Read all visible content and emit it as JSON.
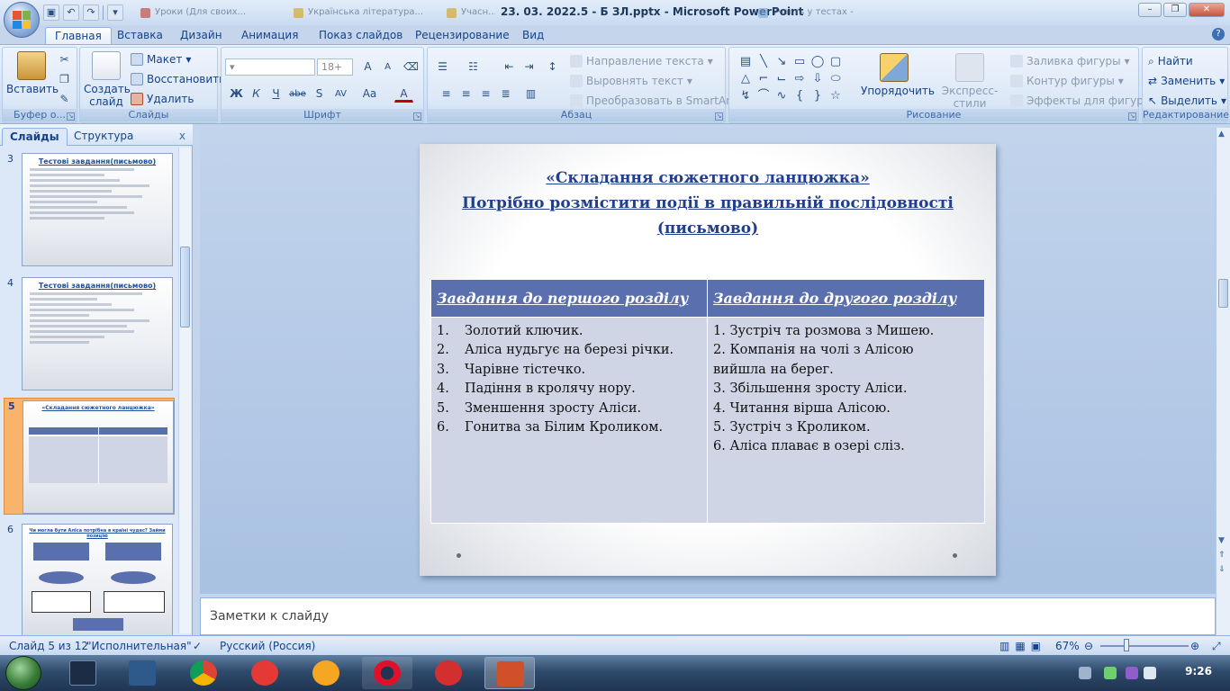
{
  "window": {
    "title": "23. 03. 2022.5 - Б ЗЛ.pptx - Microsoft PowerPoint",
    "background_tabs": [
      "Уроки (Для своих...",
      "Українська література...",
      "Учасн...",
      "Участь у тестах - "
    ]
  },
  "ribbon": {
    "tabs": [
      "Главная",
      "Вставка",
      "Дизайн",
      "Анимация",
      "Показ слайдов",
      "Рецензирование",
      "Вид"
    ],
    "active_tab": "Главная",
    "groups": {
      "clipboard": {
        "label": "Буфер о...",
        "paste": "Вставить"
      },
      "slides": {
        "label": "Слайды",
        "new_slide": "Создать слайд",
        "layout": "Макет",
        "reset": "Восстановить",
        "delete": "Удалить"
      },
      "font": {
        "label": "Шрифт",
        "size": "18+",
        "bold": "Ж",
        "italic": "К",
        "underline": "Ч",
        "strike": "abe",
        "shadow": "S",
        "spacing": "AV",
        "case": "Aa",
        "color": "A",
        "grow": "A",
        "shrink": "A"
      },
      "paragraph": {
        "label": "Абзац",
        "text_direction": "Направление текста",
        "align_text": "Выровнять текст",
        "smartart": "Преобразовать в SmartArt"
      },
      "drawing": {
        "label": "Рисование",
        "arrange": "Упорядочить",
        "quick_styles": "Экспресс-стили",
        "fill": "Заливка фигуры",
        "outline": "Контур фигуры",
        "effects": "Эффекты для фигур"
      },
      "editing": {
        "label": "Редактирование",
        "find": "Найти",
        "replace": "Заменить",
        "select": "Выделить"
      }
    }
  },
  "left_pane": {
    "tabs": [
      "Слайды",
      "Структура"
    ],
    "close": "x",
    "thumbs": [
      {
        "num": "3",
        "title": "Тестові завдання(письмово)"
      },
      {
        "num": "4",
        "title": "Тестові завдання(письмово)"
      },
      {
        "num": "5",
        "title": "«Складання сюжетного ланцюжка»"
      },
      {
        "num": "6",
        "title": "Чи могла бути Аліса потрібна в країні чудес? Займи позицію"
      }
    ]
  },
  "slide": {
    "title_line1": "«Складання сюжетного ланцюжка»",
    "title_line2": "Потрібно розмістити події в правильній послідовності",
    "title_line3": "(письмово)",
    "col1_header": "Завдання до першого розділу",
    "col2_header": "Завдання до другого розділу",
    "col1_items": [
      {
        "n": "1.",
        "text": "Золотий ключик."
      },
      {
        "n": "2.",
        "text": "Аліса нудьгує на березі річки."
      },
      {
        "n": "3.",
        "text": "Чарівне тістечко."
      },
      {
        "n": "4.",
        "text": "Падіння в кролячу нору."
      },
      {
        "n": "5.",
        "text": "Зменшення зросту Аліси."
      },
      {
        "n": "6.",
        "text": "Гонитва за Білим Кроликом."
      }
    ],
    "col2_lines": [
      "1. Зустріч та розмова з Мишею.",
      "2. Компанія на чолі з Алісою",
      "вийшла на берег.",
      "3. Збільшення зросту Аліси.",
      "4. Читання вірша Алісою.",
      "5. Зустріч з Кроликом.",
      "6. Аліса плаває в озері сліз."
    ]
  },
  "notes": {
    "placeholder": "Заметки к слайду"
  },
  "status": {
    "slide_counter": "Слайд 5 из 12",
    "theme": "\"Исполнительная\"",
    "language": "Русский (Россия)",
    "zoom": "67%"
  },
  "taskbar": {
    "clock": "9:26"
  }
}
